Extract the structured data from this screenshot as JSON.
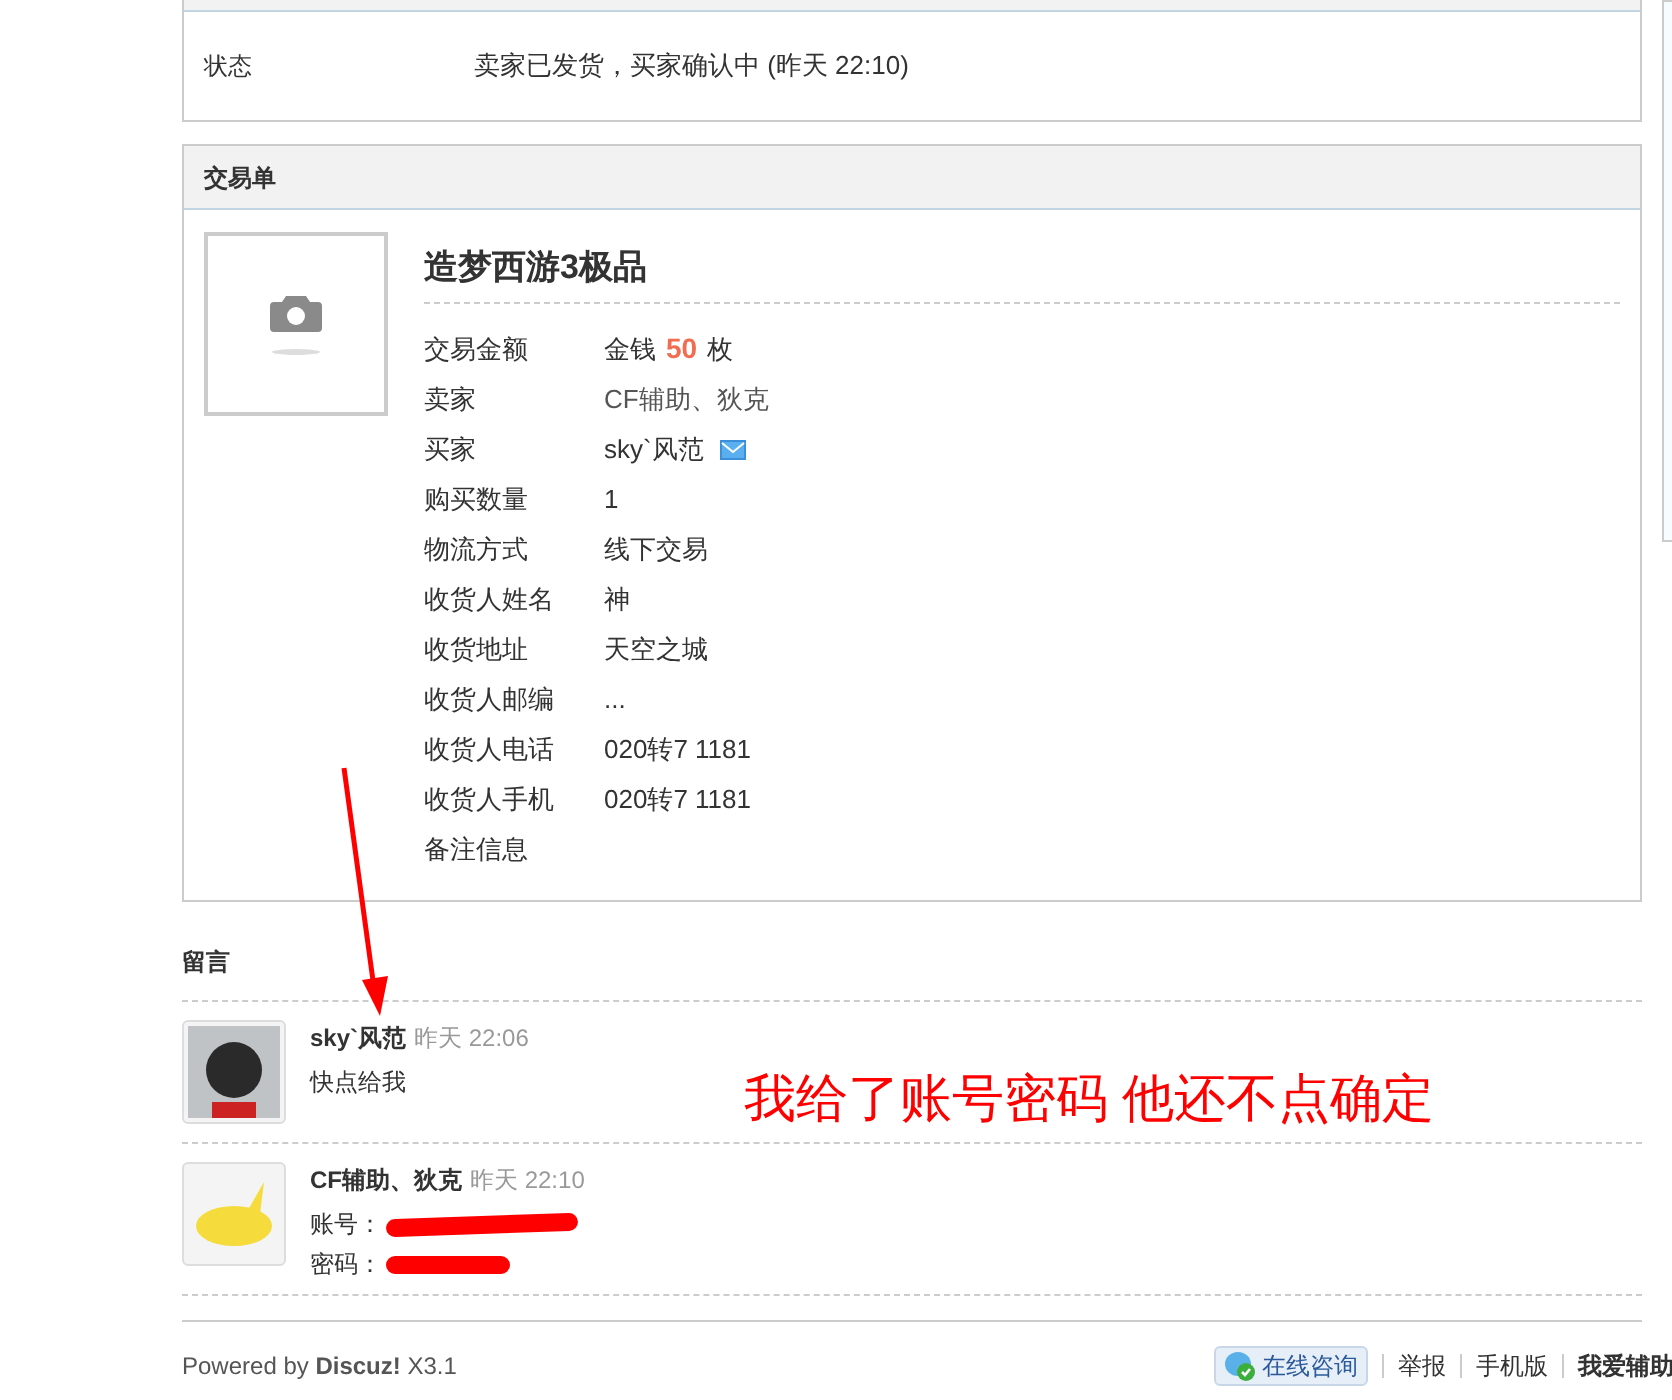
{
  "status_panel": {
    "label": "状态",
    "value": "卖家已发货，买家确认中 (昨天 22:10)"
  },
  "trade_panel": {
    "title": "交易单",
    "item_title": "造梦西游3极品",
    "fields": [
      {
        "label": "交易金额",
        "kind": "price",
        "prefix": "金钱",
        "amount": "50",
        "unit": "枚"
      },
      {
        "label": "卖家",
        "kind": "link",
        "value": "CF辅助、狄克"
      },
      {
        "label": "买家",
        "kind": "user",
        "value": "sky`风范"
      },
      {
        "label": "购买数量",
        "kind": "text",
        "value": "1"
      },
      {
        "label": "物流方式",
        "kind": "text",
        "value": "线下交易"
      },
      {
        "label": "收货人姓名",
        "kind": "text",
        "value": "神"
      },
      {
        "label": "收货地址",
        "kind": "text",
        "value": "天空之城"
      },
      {
        "label": "收货人邮编",
        "kind": "text",
        "value": "..."
      },
      {
        "label": "收货人电话",
        "kind": "text",
        "value": "020转7 1181"
      },
      {
        "label": "收货人手机",
        "kind": "text",
        "value": "020转7 1181"
      },
      {
        "label": "备注信息",
        "kind": "text"
      }
    ]
  },
  "messages_title": "留言",
  "messages": [
    {
      "author": "sky`风范",
      "time": "昨天 22:06",
      "lines": [
        "快点给我"
      ],
      "redacted": false
    },
    {
      "author": "CF辅助、狄克",
      "time": "昨天 22:10",
      "lines": [
        "账号：",
        "密码："
      ],
      "redacted": true
    }
  ],
  "annotation": {
    "text": "我给了账号密码 他还不点确定"
  },
  "footer": {
    "powered_prefix": "Powered by",
    "brand": "Discuz!",
    "version": "X3.1",
    "consult_button": "在线咨询",
    "links": [
      "举报",
      "手机版",
      "我爱辅助"
    ]
  }
}
